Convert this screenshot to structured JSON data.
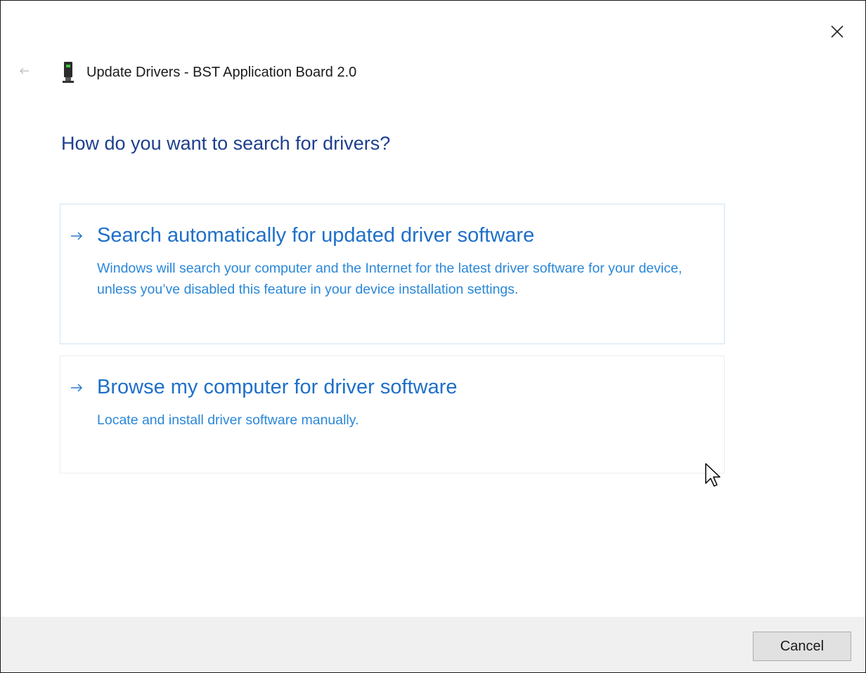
{
  "window": {
    "title": "Update Drivers - BST Application Board 2.0",
    "close_icon": "close-icon",
    "back_icon": "back-arrow-icon",
    "device_icon": "usb-device-icon"
  },
  "main": {
    "heading": "How do you want to search for drivers?",
    "options": [
      {
        "icon": "arrow-right-icon",
        "title": "Search automatically for updated driver software",
        "description": "Windows will search your computer and the Internet for the latest driver software for your device, unless you’ve disabled this feature in your device installation settings."
      },
      {
        "icon": "arrow-right-icon",
        "title": "Browse my computer for driver software",
        "description": "Locate and install driver software manually."
      }
    ]
  },
  "footer": {
    "cancel_label": "Cancel"
  },
  "colors": {
    "heading": "#1e3f8e",
    "link_title": "#1e6fc8",
    "link_desc": "#2a87d8",
    "footer_bg": "#f0f0f0"
  }
}
